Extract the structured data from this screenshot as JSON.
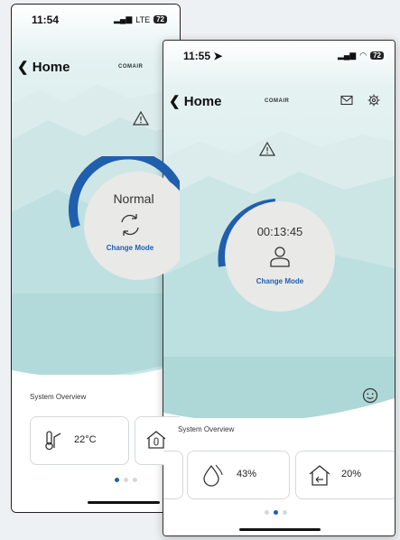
{
  "left_screen": {
    "status": {
      "time": "11:54",
      "network": "LTE",
      "battery": "72"
    },
    "header": {
      "back_label": "Home",
      "brand": "COMAIR"
    },
    "mode": {
      "label": "Normal",
      "change_mode": "Change Mode"
    },
    "overview": {
      "title": "System Overview",
      "cards": [
        {
          "value": "22°C"
        }
      ]
    }
  },
  "right_screen": {
    "status": {
      "time": "11:55",
      "battery": "72"
    },
    "header": {
      "back_label": "Home",
      "brand": "COMAIR"
    },
    "mode": {
      "timer": "00:13:45",
      "change_mode": "Change Mode"
    },
    "overview": {
      "title": "System Overview",
      "cards": [
        {
          "value": "43%"
        },
        {
          "value": "20%"
        }
      ]
    }
  },
  "colors": {
    "accent": "#1f5fae",
    "sky": "#cfe9e9",
    "mountain": "#a8d6d6"
  },
  "icons": [
    "warning-icon",
    "mail-icon",
    "gear-icon",
    "cycle-arrows-icon",
    "person-icon",
    "thermometer-icon",
    "humidity-drop-icon",
    "house-exchange-icon",
    "smiley-icon"
  ]
}
